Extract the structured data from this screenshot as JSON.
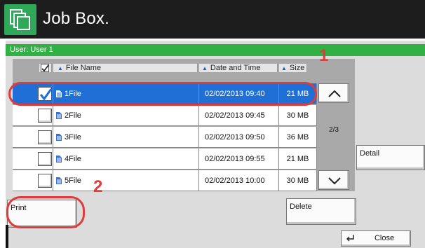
{
  "app": {
    "title": "Job Box."
  },
  "user_bar": {
    "label": "User:  User 1"
  },
  "list": {
    "headers": {
      "name": "File Name",
      "date": "Date and Time",
      "size": "Size"
    },
    "rows": [
      {
        "name": "1File",
        "date": "02/02/2013 09:40",
        "size": "21 MB",
        "selected": true
      },
      {
        "name": "2File",
        "date": "02/02/2013 09:45",
        "size": "30 MB",
        "selected": false
      },
      {
        "name": "3File",
        "date": "02/02/2013 09:50",
        "size": "36 MB",
        "selected": false
      },
      {
        "name": "4File",
        "date": "02/02/2013 09:55",
        "size": "21 MB",
        "selected": false
      },
      {
        "name": "5File",
        "date": "02/02/2013 10:00",
        "size": "30 MB",
        "selected": false
      }
    ],
    "page_indicator": "2/3"
  },
  "buttons": {
    "detail": "Detail",
    "print": "Print",
    "delete": "Delete",
    "close": "Close"
  },
  "callouts": {
    "one": "1",
    "two": "2"
  },
  "colors": {
    "title_bar": "#1d1d1d",
    "user_bar": "#31b043",
    "selection": "#1f6fd6",
    "callout": "#e03a3a"
  }
}
